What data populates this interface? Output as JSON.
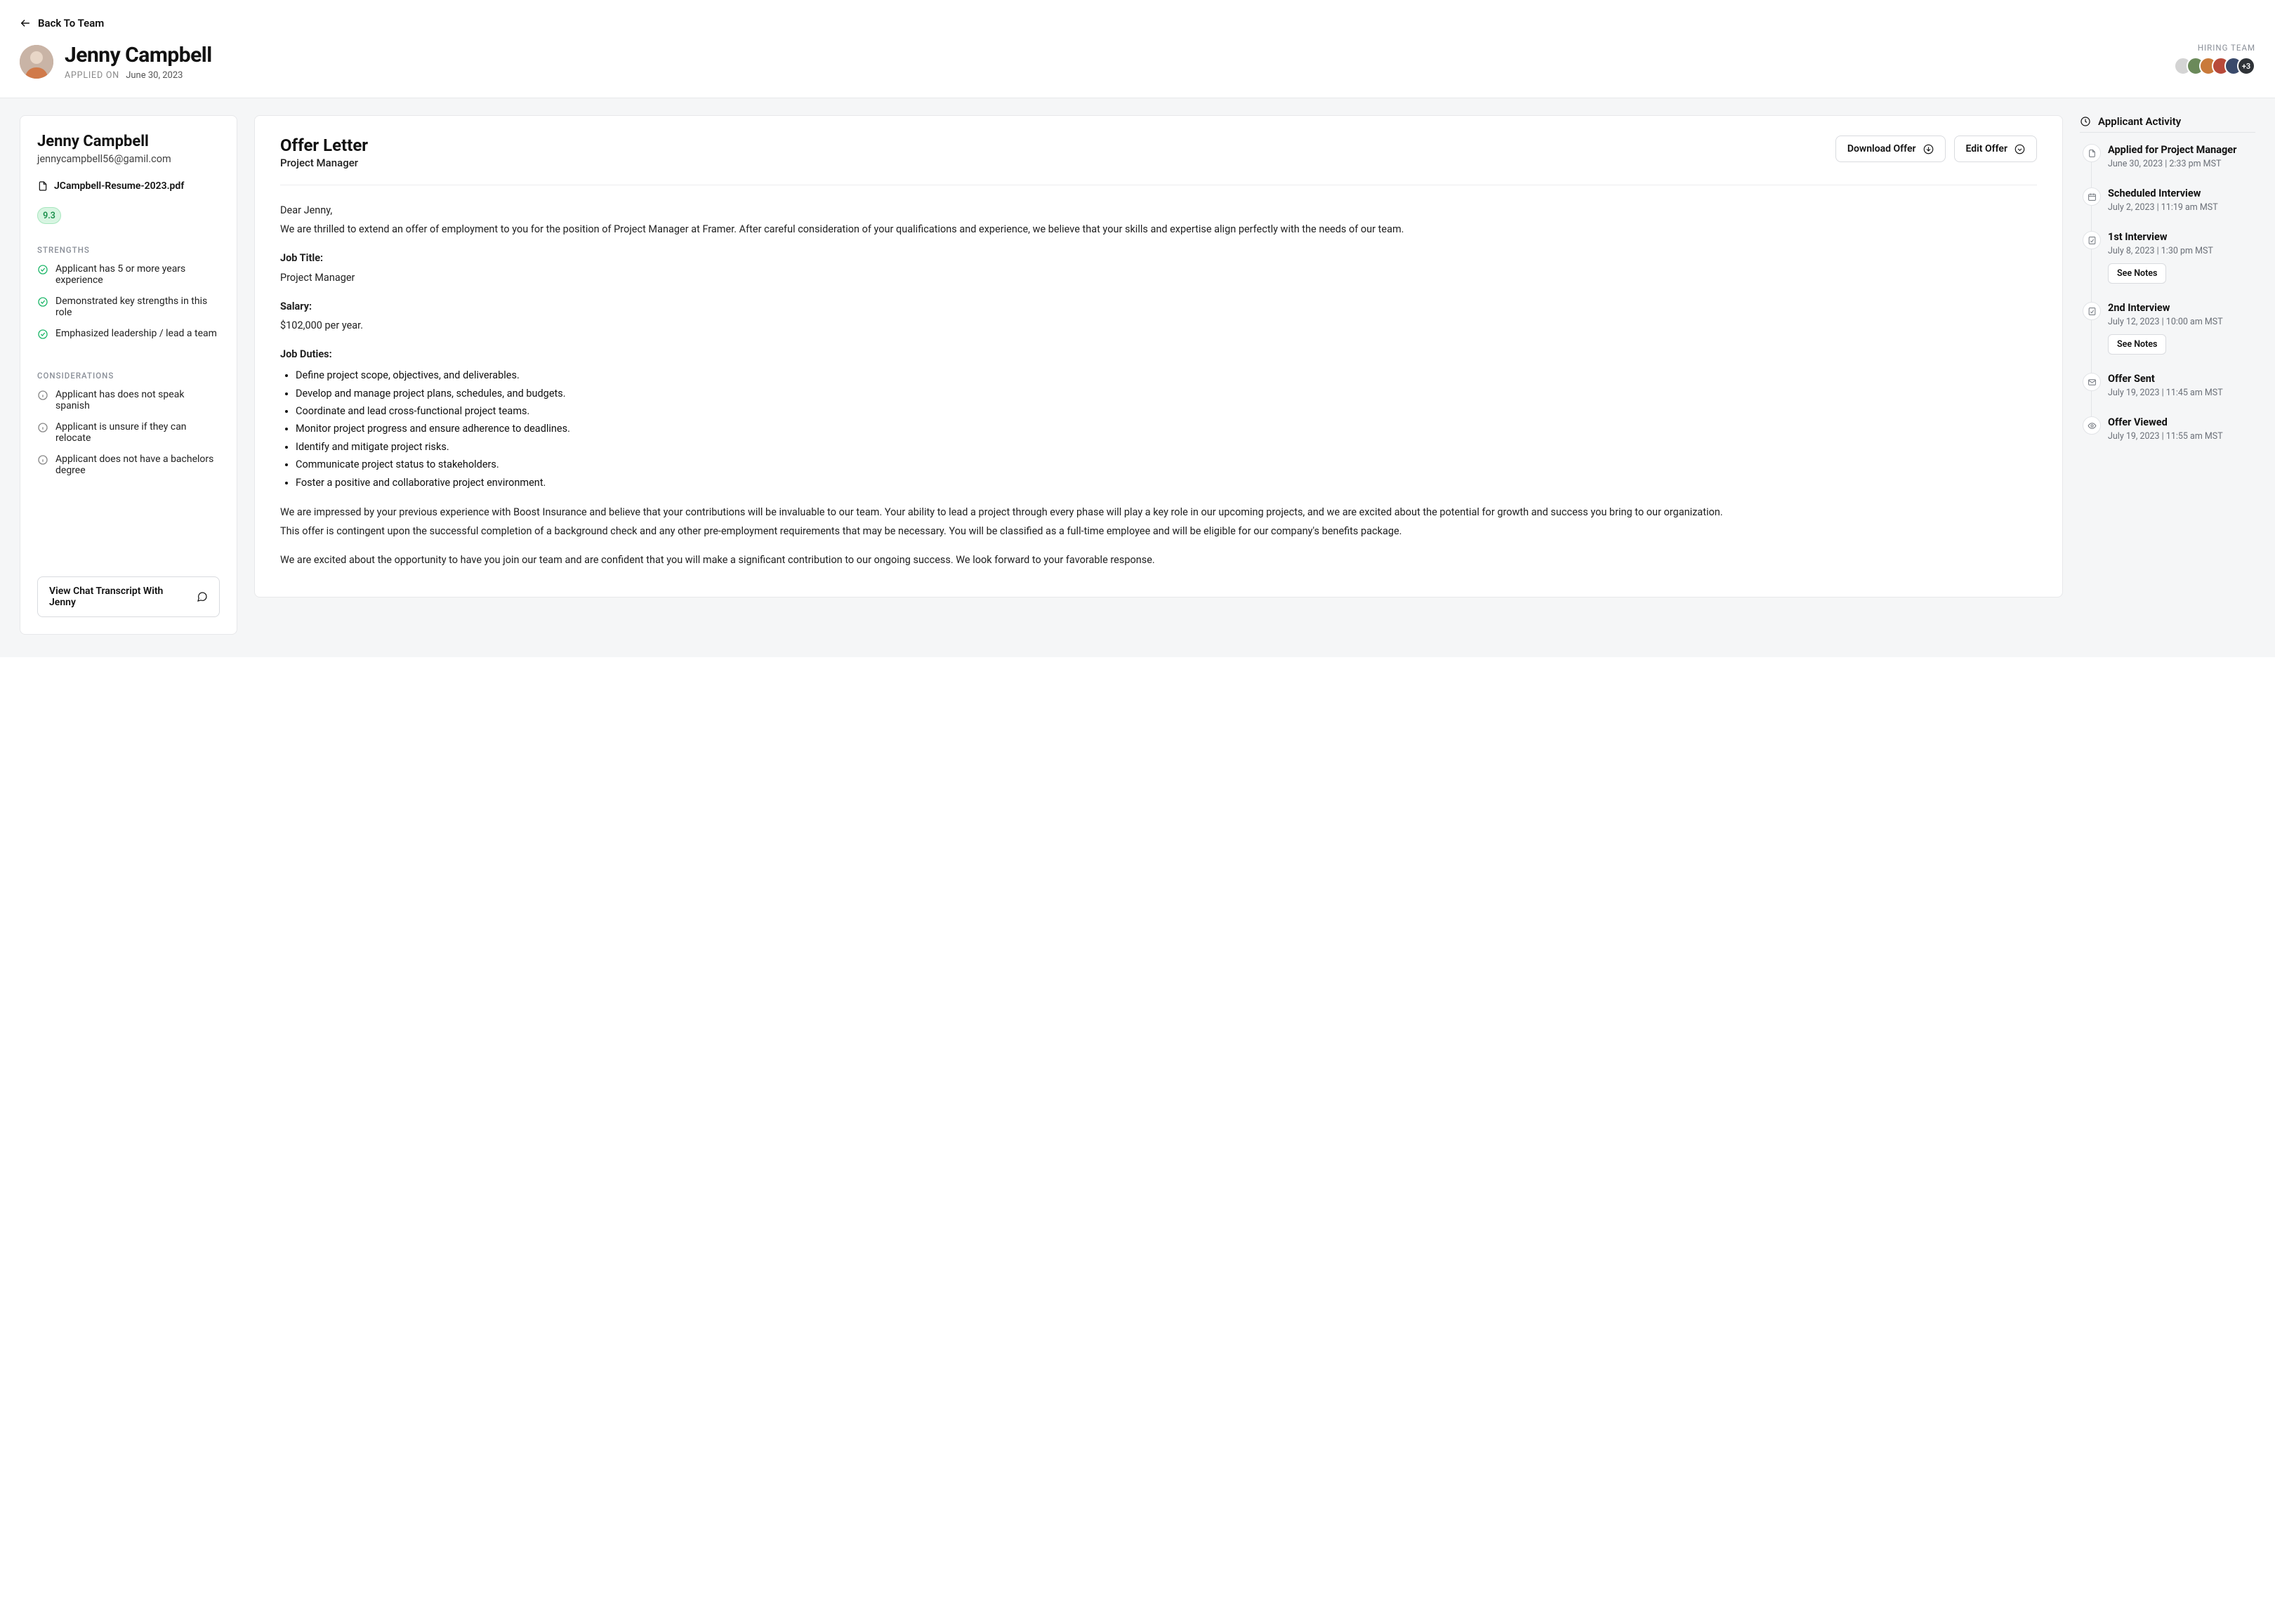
{
  "nav": {
    "back_label": "Back To Team"
  },
  "header": {
    "candidate_name": "Jenny Campbell",
    "applied_label": "APPLIED ON",
    "applied_date": "June 30, 2023",
    "hiring_team_label": "HIRING TEAM",
    "hiring_team_more": "+3"
  },
  "profile": {
    "name": "Jenny Campbell",
    "email": "jennycampbell56@gamil.com",
    "resume_filename": "JCampbell-Resume-2023.pdf",
    "score": "9.3",
    "strengths_label": "STRENGTHS",
    "strengths": [
      "Applicant has 5 or more years experience",
      "Demonstrated key strengths in this role",
      "Emphasized leadership / lead a team"
    ],
    "considerations_label": "CONSIDERATIONS",
    "considerations": [
      "Applicant has does not speak spanish",
      "Applicant is unsure if they can relocate",
      "Applicant does not have a bachelors degree"
    ],
    "transcript_button": "View Chat Transcript With Jenny"
  },
  "offer": {
    "title": "Offer Letter",
    "subtitle": "Project Manager",
    "download_label": "Download Offer",
    "edit_label": "Edit Offer",
    "greeting": "Dear Jenny,",
    "intro": "We are thrilled to extend an offer of employment to you for the position of Project Manager at Framer. After careful consideration of your qualifications and experience, we believe that your skills and expertise align perfectly with the needs of our team.",
    "job_title_label": "Job Title:",
    "job_title_value": "Project Manager",
    "salary_label": "Salary:",
    "salary_value": "$102,000 per year.",
    "duties_label": "Job Duties:",
    "duties": [
      "Define project scope, objectives, and deliverables.",
      "Develop and manage project plans, schedules, and budgets.",
      "Coordinate and lead cross-functional project teams.",
      "Monitor project progress and ensure adherence to deadlines.",
      "Identify and mitigate project risks.",
      "Communicate project status to stakeholders.",
      "Foster a positive and collaborative project environment."
    ],
    "closing1": "We are impressed by your previous experience with Boost Insurance and believe that your contributions will be invaluable to our team. Your ability to lead a project through every phase will play a key role in our upcoming projects, and we are excited about the potential for growth and success you bring to our organization.",
    "closing2": "This offer is contingent upon the successful completion of a background check and any other pre-employment requirements that may be necessary. You will be classified as a full-time employee and will be eligible for our company's benefits package.",
    "closing3": "We are excited about the opportunity to have you join our team and are confident that you will make a significant contribution to our ongoing success. We look forward to your favorable response."
  },
  "activity": {
    "heading": "Applicant Activity",
    "see_notes_label": "See Notes",
    "items": [
      {
        "icon": "doc",
        "title": "Applied for Project Manager",
        "date": "June 30, 2023 | 2:33 pm MST",
        "notes": false
      },
      {
        "icon": "calendar",
        "title": "Scheduled Interview",
        "date": "July 2, 2023 | 11:19 am MST",
        "notes": false
      },
      {
        "icon": "note",
        "title": "1st Interview",
        "date": "July 8, 2023 | 1:30 pm MST",
        "notes": true
      },
      {
        "icon": "note",
        "title": "2nd Interview",
        "date": "July 12, 2023 | 10:00 am MST",
        "notes": true
      },
      {
        "icon": "mail",
        "title": "Offer Sent",
        "date": "July 19, 2023 | 11:45 am MST",
        "notes": false
      },
      {
        "icon": "eye",
        "title": "Offer Viewed",
        "date": "July 19, 2023 | 11:55 am MST",
        "notes": false
      }
    ]
  }
}
